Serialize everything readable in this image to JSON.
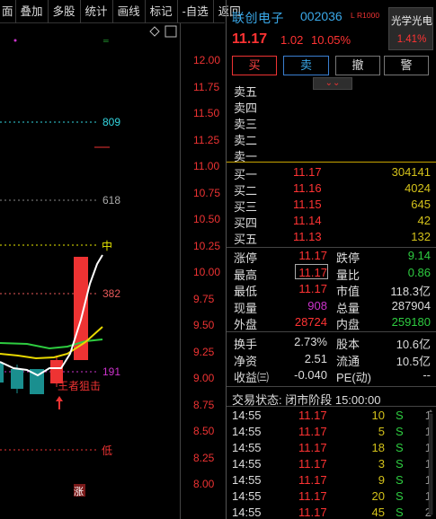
{
  "toolbar": {
    "items": [
      "叠加",
      "多股",
      "统计",
      "画线",
      "标记",
      "-自选",
      "返回"
    ],
    "first_partial": "面"
  },
  "chart": {
    "y_ticks": [
      "12.00",
      "11.75",
      "11.50",
      "11.25",
      "11.00",
      "10.75",
      "10.50",
      "10.25",
      "10.00",
      "9.75",
      "9.50",
      "9.25",
      "9.00",
      "8.75",
      "8.50",
      "8.25",
      "8.00"
    ],
    "fib_levels": [
      {
        "label": "809",
        "color": "#33d6e0"
      },
      {
        "label": "618",
        "color": "#aaaaaa"
      },
      {
        "label": "中",
        "color": "#e8e800"
      },
      {
        "label": "382",
        "color": "#e85a5a"
      },
      {
        "label": "191",
        "color": "#cc33cc"
      },
      {
        "label": "低",
        "color": "#e33333"
      }
    ],
    "annotation": "王者狙击",
    "bottom_mark": "涨",
    "corner_icon": "diamond-icon"
  },
  "stock": {
    "name": "联创电子",
    "code": "002036",
    "tag_l": "L",
    "tag_r": "R1000",
    "price": "11.17",
    "change": "1.02",
    "change_pct": "10.05%",
    "sector_name": "光学光电",
    "sector_pct": "1.41%"
  },
  "actions": {
    "buy": "买",
    "sell": "卖",
    "cancel": "撤",
    "alert": "警",
    "collapse": "⌄⌄"
  },
  "asks": [
    "卖五",
    "卖四",
    "卖三",
    "卖二",
    "卖一"
  ],
  "bids": [
    {
      "label": "买一",
      "price": "11.17",
      "vol": "304141"
    },
    {
      "label": "买二",
      "price": "11.16",
      "vol": "4024"
    },
    {
      "label": "买三",
      "price": "11.15",
      "vol": "645"
    },
    {
      "label": "买四",
      "price": "11.14",
      "vol": "42"
    },
    {
      "label": "买五",
      "price": "11.13",
      "vol": "132"
    }
  ],
  "stats": [
    {
      "l1": "涨停",
      "v1": "11.17",
      "c1": "#f33",
      "l2": "跌停",
      "v2": "9.14",
      "c2": "#2ecc40"
    },
    {
      "l1": "最高",
      "v1": "11.17",
      "c1": "#f33",
      "l2": "量比",
      "v2": "0.86",
      "c2": "#2ecc40"
    },
    {
      "l1": "最低",
      "v1": "11.17",
      "c1": "#f33",
      "l2": "市值",
      "v2": "118.3亿",
      "c2": "#ddd"
    },
    {
      "l1": "现量",
      "v1": "908",
      "c1": "#cc33cc",
      "l2": "总量",
      "v2": "287904",
      "c2": "#ddd"
    },
    {
      "l1": "外盘",
      "v1": "28724",
      "c1": "#f33",
      "l2": "内盘",
      "v2": "259180",
      "c2": "#2ecc40"
    }
  ],
  "stats2": [
    {
      "l1": "换手",
      "v1": "2.73%",
      "c1": "#ddd",
      "l2": "股本",
      "v2": "10.6亿",
      "c2": "#ddd"
    },
    {
      "l1": "净资",
      "v1": "2.51",
      "c1": "#ddd",
      "l2": "流通",
      "v2": "10.5亿",
      "c2": "#ddd"
    },
    {
      "l1": "收益㈢",
      "v1": "-0.040",
      "c1": "#ddd",
      "l2": "PE(动)",
      "v2": "--",
      "c2": "#ddd"
    }
  ],
  "status": "交易状态: 闭市阶段 15:00:00",
  "ticks": [
    {
      "time": "14:55",
      "price": "11.17",
      "vol": "10",
      "side": "S",
      "n": "1"
    },
    {
      "time": "14:55",
      "price": "11.17",
      "vol": "5",
      "side": "S",
      "n": "1"
    },
    {
      "time": "14:55",
      "price": "11.17",
      "vol": "18",
      "side": "S",
      "n": "1"
    },
    {
      "time": "14:55",
      "price": "11.17",
      "vol": "3",
      "side": "S",
      "n": "1"
    },
    {
      "time": "14:55",
      "price": "11.17",
      "vol": "9",
      "side": "S",
      "n": "1"
    },
    {
      "time": "14:55",
      "price": "11.17",
      "vol": "20",
      "side": "S",
      "n": "1"
    },
    {
      "time": "14:55",
      "price": "11.17",
      "vol": "45",
      "side": "S",
      "n": "2"
    }
  ]
}
